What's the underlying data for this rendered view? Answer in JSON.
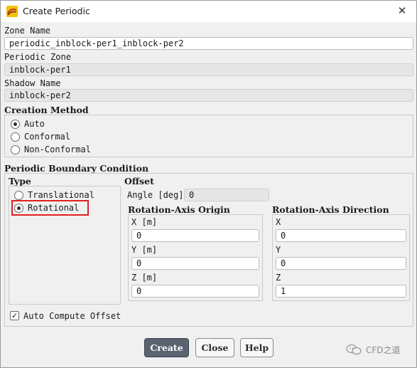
{
  "window": {
    "title": "Create Periodic",
    "close_glyph": "✕",
    "icon": "fluent-app-icon"
  },
  "zone_name": {
    "label": "Zone Name",
    "value": "periodic_inblock-per1_inblock-per2"
  },
  "periodic_zone": {
    "label": "Periodic Zone",
    "value": "inblock-per1"
  },
  "shadow_name": {
    "label": "Shadow Name",
    "value": "inblock-per2"
  },
  "creation_method": {
    "label": "Creation Method",
    "options": [
      {
        "label": "Auto",
        "selected": true
      },
      {
        "label": "Conformal",
        "selected": false
      },
      {
        "label": "Non-Conformal",
        "selected": false
      }
    ]
  },
  "pbc": {
    "label": "Periodic Boundary Condition",
    "type": {
      "label": "Type",
      "options": [
        {
          "label": "Translational",
          "selected": false
        },
        {
          "label": "Rotational",
          "selected": true
        }
      ]
    },
    "offset": {
      "label": "Offset",
      "angle_label": "Angle [deg]",
      "angle_value": "0",
      "origin": {
        "label": "Rotation-Axis Origin",
        "x_label": "X [m]",
        "x": "0",
        "y_label": "Y [m]",
        "y": "0",
        "z_label": "Z [m]",
        "z": "0"
      },
      "direction": {
        "label": "Rotation-Axis Direction",
        "x_label": "X",
        "x": "0",
        "y_label": "Y",
        "y": "0",
        "z_label": "Z",
        "z": "1"
      }
    },
    "auto_compute": {
      "label": "Auto Compute Offset",
      "checked": true,
      "glyph": "✓"
    }
  },
  "buttons": {
    "create": "Create",
    "close": "Close",
    "help": "Help"
  },
  "watermark": {
    "text": "CFD之道",
    "icon": "wechat-icon"
  },
  "colors": {
    "primary_button": "#5a6470",
    "highlight": "#e02020"
  }
}
